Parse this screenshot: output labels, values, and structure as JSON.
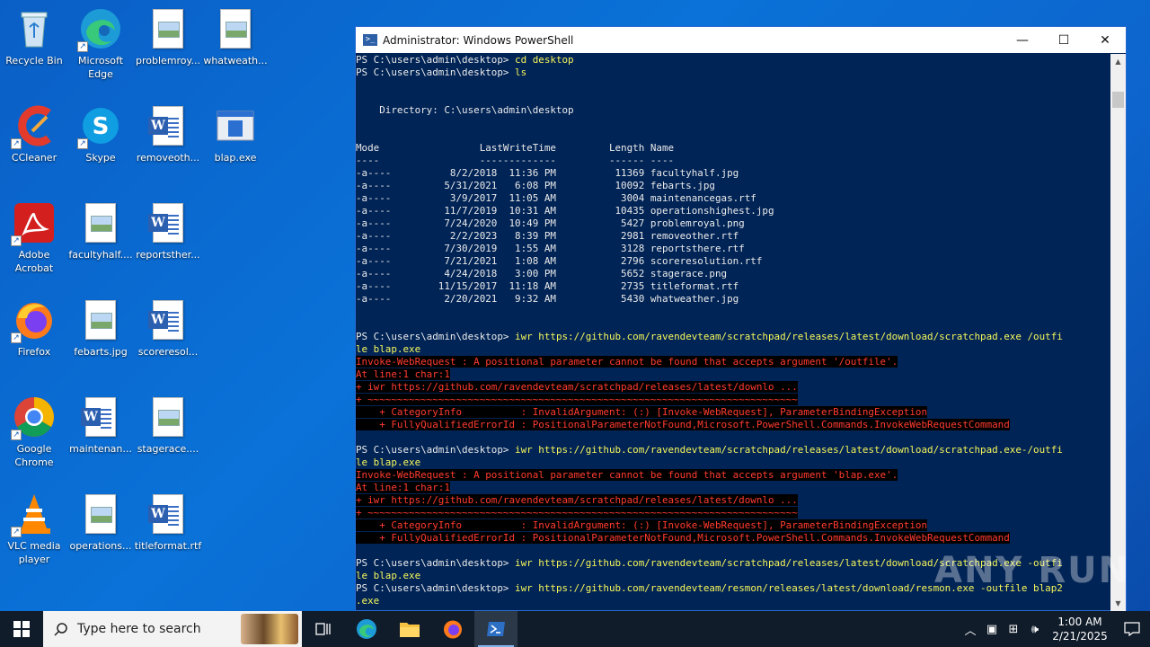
{
  "desktop": {
    "icons": [
      {
        "label": "Recycle Bin"
      },
      {
        "label": "Microsoft Edge"
      },
      {
        "label": "problemroy..."
      },
      {
        "label": "whatweath..."
      },
      {
        "label": "CCleaner"
      },
      {
        "label": "Skype"
      },
      {
        "label": "removeoth..."
      },
      {
        "label": "blap.exe"
      },
      {
        "label": "Adobe Acrobat"
      },
      {
        "label": "facultyhalf...."
      },
      {
        "label": "reportsther..."
      },
      {
        "label": "Firefox"
      },
      {
        "label": "febarts.jpg"
      },
      {
        "label": "scoreresol..."
      },
      {
        "label": "Google Chrome"
      },
      {
        "label": "maintenan..."
      },
      {
        "label": "stagerace...."
      },
      {
        "label": "VLC media player"
      },
      {
        "label": "operations..."
      },
      {
        "label": "titleformat.rtf"
      }
    ]
  },
  "window": {
    "title": "Administrator: Windows PowerShell",
    "minimize": "—",
    "maximize": "☐",
    "close": "✕"
  },
  "console": {
    "lines": [
      {
        "t": "PS C:\\users\\admin\\desktop> ",
        "c": "cd desktop"
      },
      {
        "t": "PS C:\\users\\admin\\desktop> ",
        "c": "ls"
      },
      {
        "t": ""
      },
      {
        "t": ""
      },
      {
        "t": "    Directory: C:\\users\\admin\\desktop"
      },
      {
        "t": ""
      },
      {
        "t": ""
      },
      {
        "t": "Mode                 LastWriteTime         Length Name"
      },
      {
        "t": "----                 -------------         ------ ----"
      },
      {
        "t": "-a----          8/2/2018  11:36 PM          11369 facultyhalf.jpg"
      },
      {
        "t": "-a----         5/31/2021   6:08 PM          10092 febarts.jpg"
      },
      {
        "t": "-a----          3/9/2017  11:05 AM           3004 maintenancegas.rtf"
      },
      {
        "t": "-a----         11/7/2019  10:31 AM          10435 operationshighest.jpg"
      },
      {
        "t": "-a----         7/24/2020  10:49 PM           5427 problemroyal.png"
      },
      {
        "t": "-a----          2/2/2023   8:39 PM           2981 removeother.rtf"
      },
      {
        "t": "-a----         7/30/2019   1:55 AM           3128 reportsthere.rtf"
      },
      {
        "t": "-a----         7/21/2021   1:08 AM           2796 scoreresolution.rtf"
      },
      {
        "t": "-a----         4/24/2018   3:00 PM           5652 stagerace.png"
      },
      {
        "t": "-a----        11/15/2017  11:18 AM           2735 titleformat.rtf"
      },
      {
        "t": "-a----         2/20/2021   9:32 AM           5430 whatweather.jpg"
      },
      {
        "t": ""
      },
      {
        "t": ""
      },
      {
        "t": "PS C:\\users\\admin\\desktop> ",
        "c": "iwr https://github.com/ravendevteam/scratchpad/releases/latest/download/scratchpad.exe /outfi"
      },
      {
        "t": "",
        "c": "le blap.exe"
      },
      {
        "e": "Invoke-WebRequest : A positional parameter cannot be found that accepts argument '/outfile'."
      },
      {
        "e": "At line:1 char:1"
      },
      {
        "e": "+ iwr https://github.com/ravendevteam/scratchpad/releases/latest/downlo ..."
      },
      {
        "e": "+ ~~~~~~~~~~~~~~~~~~~~~~~~~~~~~~~~~~~~~~~~~~~~~~~~~~~~~~~~~~~~~~~~~~~~~~~~~"
      },
      {
        "e": "    + CategoryInfo          : InvalidArgument: (:) [Invoke-WebRequest], ParameterBindingException"
      },
      {
        "e": "    + FullyQualifiedErrorId : PositionalParameterNotFound,Microsoft.PowerShell.Commands.InvokeWebRequestCommand"
      },
      {
        "t": ""
      },
      {
        "t": "PS C:\\users\\admin\\desktop> ",
        "c": "iwr https://github.com/ravendevteam/scratchpad/releases/latest/download/scratchpad.exe-/outfi"
      },
      {
        "t": "",
        "c": "le blap.exe"
      },
      {
        "e": "Invoke-WebRequest : A positional parameter cannot be found that accepts argument 'blap.exe'."
      },
      {
        "e": "At line:1 char:1"
      },
      {
        "e": "+ iwr https://github.com/ravendevteam/scratchpad/releases/latest/downlo ..."
      },
      {
        "e": "+ ~~~~~~~~~~~~~~~~~~~~~~~~~~~~~~~~~~~~~~~~~~~~~~~~~~~~~~~~~~~~~~~~~~~~~~~~~"
      },
      {
        "e": "    + CategoryInfo          : InvalidArgument: (:) [Invoke-WebRequest], ParameterBindingException"
      },
      {
        "e": "    + FullyQualifiedErrorId : PositionalParameterNotFound,Microsoft.PowerShell.Commands.InvokeWebRequestCommand"
      },
      {
        "t": ""
      },
      {
        "t": "PS C:\\users\\admin\\desktop> ",
        "c": "iwr https://github.com/ravendevteam/scratchpad/releases/latest/download/scratchpad.exe -outfi"
      },
      {
        "t": "",
        "c": "le blap.exe"
      },
      {
        "t": "PS C:\\users\\admin\\desktop> ",
        "c": "iwr https://github.com/ravendevteam/resmon/releases/latest/download/resmon.exe -outfile blap2"
      },
      {
        "t": "",
        "c": ".exe"
      }
    ]
  },
  "watermark": "ANY RUN",
  "taskbar": {
    "search_placeholder": "Type here to search",
    "time": "1:00 AM",
    "date": "2/21/2025",
    "accent": "#7fb3ea"
  }
}
